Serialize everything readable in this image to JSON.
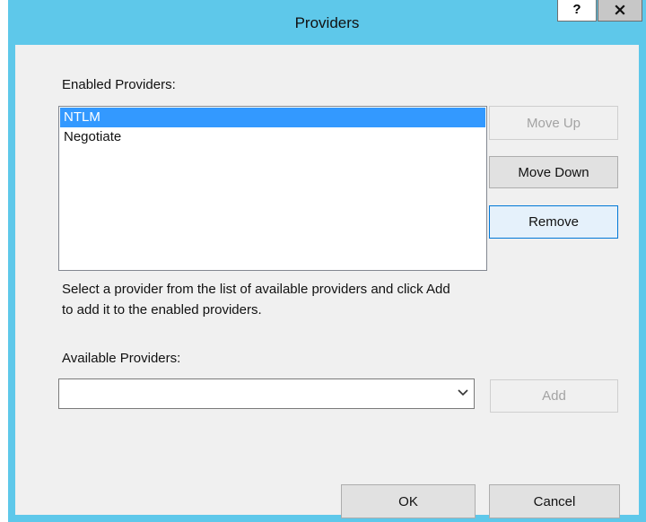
{
  "window": {
    "title": "Providers",
    "help_label": "?",
    "close_label": "x"
  },
  "enabled": {
    "label": "Enabled Providers:",
    "items": [
      {
        "label": "NTLM",
        "selected": true
      },
      {
        "label": "Negotiate",
        "selected": false
      }
    ]
  },
  "buttons": {
    "move_up": "Move Up",
    "move_down": "Move Down",
    "remove": "Remove",
    "add": "Add",
    "ok": "OK",
    "cancel": "Cancel"
  },
  "instructions": {
    "line1": "Select a provider from the list of available providers and click Add",
    "line2": "to add it to the enabled providers."
  },
  "available": {
    "label": "Available Providers:",
    "value": ""
  },
  "icons": {
    "combo_arrow": "chevron-down-icon"
  },
  "colors": {
    "titlebar": "#5ec8ea",
    "selection": "#3399ff",
    "dialog_bg": "#f0f0f0"
  }
}
